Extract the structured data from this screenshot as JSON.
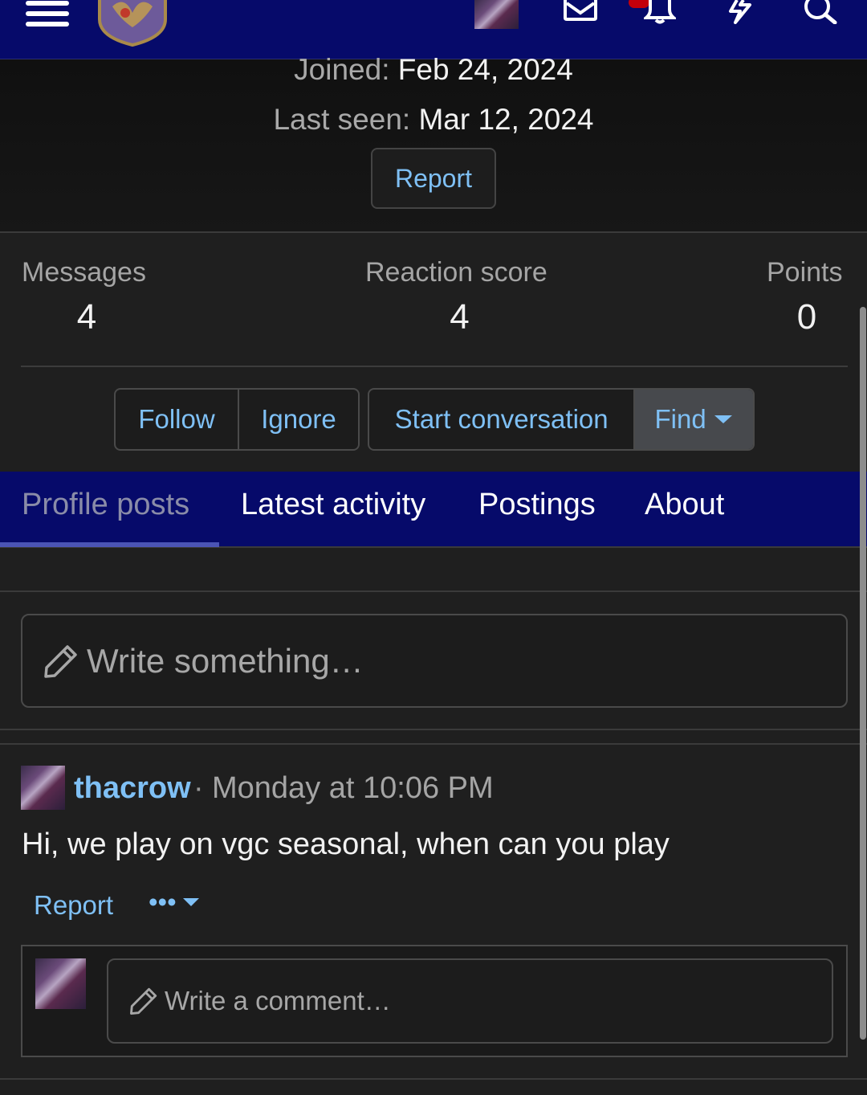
{
  "nav": {
    "icons": [
      "menu-icon",
      "site-logo",
      "user-avatar",
      "inbox-icon",
      "bell-icon",
      "lightning-icon",
      "search-icon"
    ]
  },
  "profile": {
    "joined_label": "Joined:",
    "joined_value": "Feb 24, 2024",
    "last_seen_label": "Last seen:",
    "last_seen_value": "Mar 12, 2024",
    "report_label": "Report"
  },
  "stats": [
    {
      "label": "Messages",
      "value": "4"
    },
    {
      "label": "Reaction score",
      "value": "4"
    },
    {
      "label": "Points",
      "value": "0"
    }
  ],
  "actions": {
    "follow": "Follow",
    "ignore": "Ignore",
    "start_conversation": "Start conversation",
    "find": "Find"
  },
  "tabs": [
    {
      "label": "Profile posts",
      "active": true
    },
    {
      "label": "Latest activity",
      "active": false
    },
    {
      "label": "Postings",
      "active": false
    },
    {
      "label": "About",
      "active": false
    }
  ],
  "composer": {
    "placeholder": "Write something…"
  },
  "post": {
    "author": "thacrow",
    "separator": "·",
    "time": "Monday at 10:06 PM",
    "body": "Hi, we play on vgc seasonal, when can you play",
    "report_label": "Report",
    "more_label": "•••"
  },
  "comment": {
    "placeholder": "Write a comment…"
  },
  "colors": {
    "nav_bg": "#060a6a",
    "link": "#7fc0f5",
    "page_bg": "#1f1f1f",
    "notification": "#c4000b"
  }
}
